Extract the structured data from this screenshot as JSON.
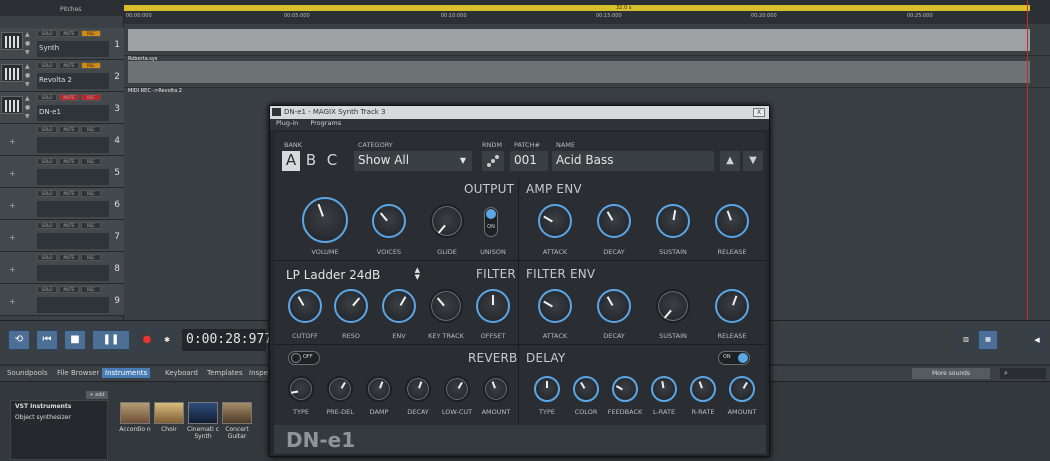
{
  "tracklist": {
    "header": "Pitches",
    "tracks": [
      {
        "name": "Synth",
        "number": "1",
        "solo": "SOLO",
        "mute": "MUTE",
        "rec": "REC"
      },
      {
        "name": "Revolta 2",
        "number": "2",
        "solo": "SOLO",
        "mute": "MUTE",
        "rec": "REC"
      },
      {
        "name": "DN-e1",
        "number": "3",
        "solo": "SOLO",
        "mute": "MUTE",
        "rec": "REC"
      },
      {
        "name": "",
        "number": "4",
        "solo": "SOLO",
        "mute": "MUTE",
        "rec": "REC"
      },
      {
        "name": "",
        "number": "5",
        "solo": "SOLO",
        "mute": "MUTE",
        "rec": "REC"
      },
      {
        "name": "",
        "number": "6",
        "solo": "SOLO",
        "mute": "MUTE",
        "rec": "REC"
      },
      {
        "name": "",
        "number": "7",
        "solo": "SOLO",
        "mute": "MUTE",
        "rec": "REC"
      },
      {
        "name": "",
        "number": "8",
        "solo": "SOLO",
        "mute": "MUTE",
        "rec": "REC"
      },
      {
        "name": "",
        "number": "9",
        "solo": "SOLO",
        "mute": "MUTE",
        "rec": "REC"
      }
    ]
  },
  "timeline": {
    "range_label": "32.0 s",
    "ticks": [
      "00:00:000",
      "00:05:000",
      "00:10:000",
      "00:15:000",
      "00:20:000",
      "00:25:000"
    ],
    "clip_labels": [
      "Roberta.sys",
      "MIDI REC ->Revolta 2"
    ]
  },
  "transport": {
    "time": "0:00:28:977"
  },
  "tabs": [
    "Soundpools",
    "File Browser",
    "Instruments",
    "Keyboard",
    "Templates",
    "Inspe"
  ],
  "browser": {
    "add_label": "+ add",
    "more_sounds": "More sounds",
    "vst_title": "VST Instruments",
    "vst_item": "Object synthesizer",
    "thumbnails": [
      "Accordio n",
      "Choir",
      "Cinemati c Synth",
      "Concert Guitar"
    ]
  },
  "synth": {
    "title": "DN-e1 - MAGIX Synth Track 3",
    "close": "X",
    "menu": [
      "Plug-in",
      "Programs"
    ],
    "bank_label": "BANK",
    "banks": [
      "A",
      "B",
      "C"
    ],
    "category_label": "CATEGORY",
    "category_value": "Show All",
    "rndm_label": "RNDM",
    "patch_label": "PATCH#",
    "patch_value": "001",
    "name_label": "NAME",
    "name_value": "Acid Bass",
    "output": {
      "header": "OUTPUT",
      "knobs": [
        "VOLUME",
        "VOICES",
        "GLIDE"
      ],
      "unison_label": "UNISON",
      "unison_state": "ON"
    },
    "amp_env": {
      "header": "AMP ENV",
      "knobs": [
        "ATTACK",
        "DECAY",
        "SUSTAIN",
        "RELEASE"
      ]
    },
    "filter": {
      "header": "FILTER",
      "type": "LP Ladder 24dB",
      "knobs": [
        "CUTOFF",
        "RESO",
        "ENV",
        "KEY TRACK",
        "OFFSET"
      ]
    },
    "filter_env": {
      "header": "FILTER ENV",
      "knobs": [
        "ATTACK",
        "DECAY",
        "SUSTAIN",
        "RELEASE"
      ]
    },
    "reverb": {
      "header": "REVERB",
      "state": "OFF",
      "knobs": [
        "TYPE",
        "PRE-DEL",
        "DAMP",
        "DECAY",
        "LOW-CUT",
        "AMOUNT"
      ]
    },
    "delay": {
      "header": "DELAY",
      "state": "ON",
      "knobs": [
        "TYPE",
        "COLOR",
        "FEEDBACK",
        "L-RATE",
        "R-RATE",
        "AMOUNT"
      ]
    },
    "brand": "DN-e1"
  }
}
